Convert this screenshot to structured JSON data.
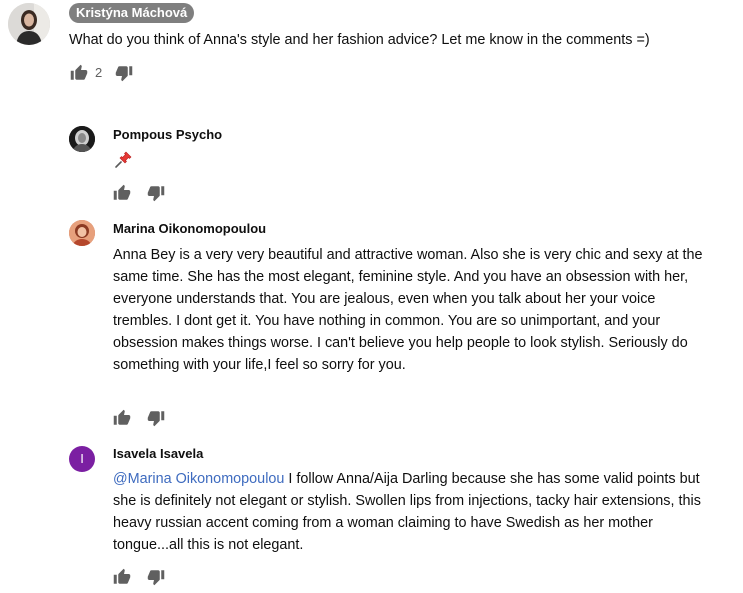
{
  "comments": [
    {
      "author": "Kristýna Máchová",
      "text": "What do you think of Anna's style and her fashion advice? Let me know in the comments =)",
      "likes": "2"
    },
    {
      "author": "Pompous Psycho",
      "text_icon": "pushpin-icon"
    },
    {
      "author": "Marina Oikonomopoulou",
      "text": "Anna Bey is a very very beautiful and attractive woman. Also she is very chic and sexy at the same time. She has the most elegant, feminine style. And you have an obsession with her, everyone understands that. You are jealous, even when you talk about her your voice trembles. I dont get it. You have nothing in common. You are so unimportant, and your obsession makes things worse. I can't believe you help people to look stylish. Seriously do something with your life,I feel so sorry for you."
    },
    {
      "author": "Isavela Isavela",
      "avatar_letter": "I",
      "mention": "@Marina Oikonomopoulou",
      "text": " I follow Anna/Aija Darling because she has some valid points but she is definitely not elegant or stylish. Swollen lips from injections, tacky hair extensions, this heavy russian accent coming from a woman claiming to have Swedish as her mother tongue...all this is not elegant."
    }
  ],
  "colors": {
    "author_chip_bg": "#7f7f7f",
    "mention": "#3e6bbf",
    "icon": "#606060",
    "isavela_avatar": "#7b1fa2"
  }
}
